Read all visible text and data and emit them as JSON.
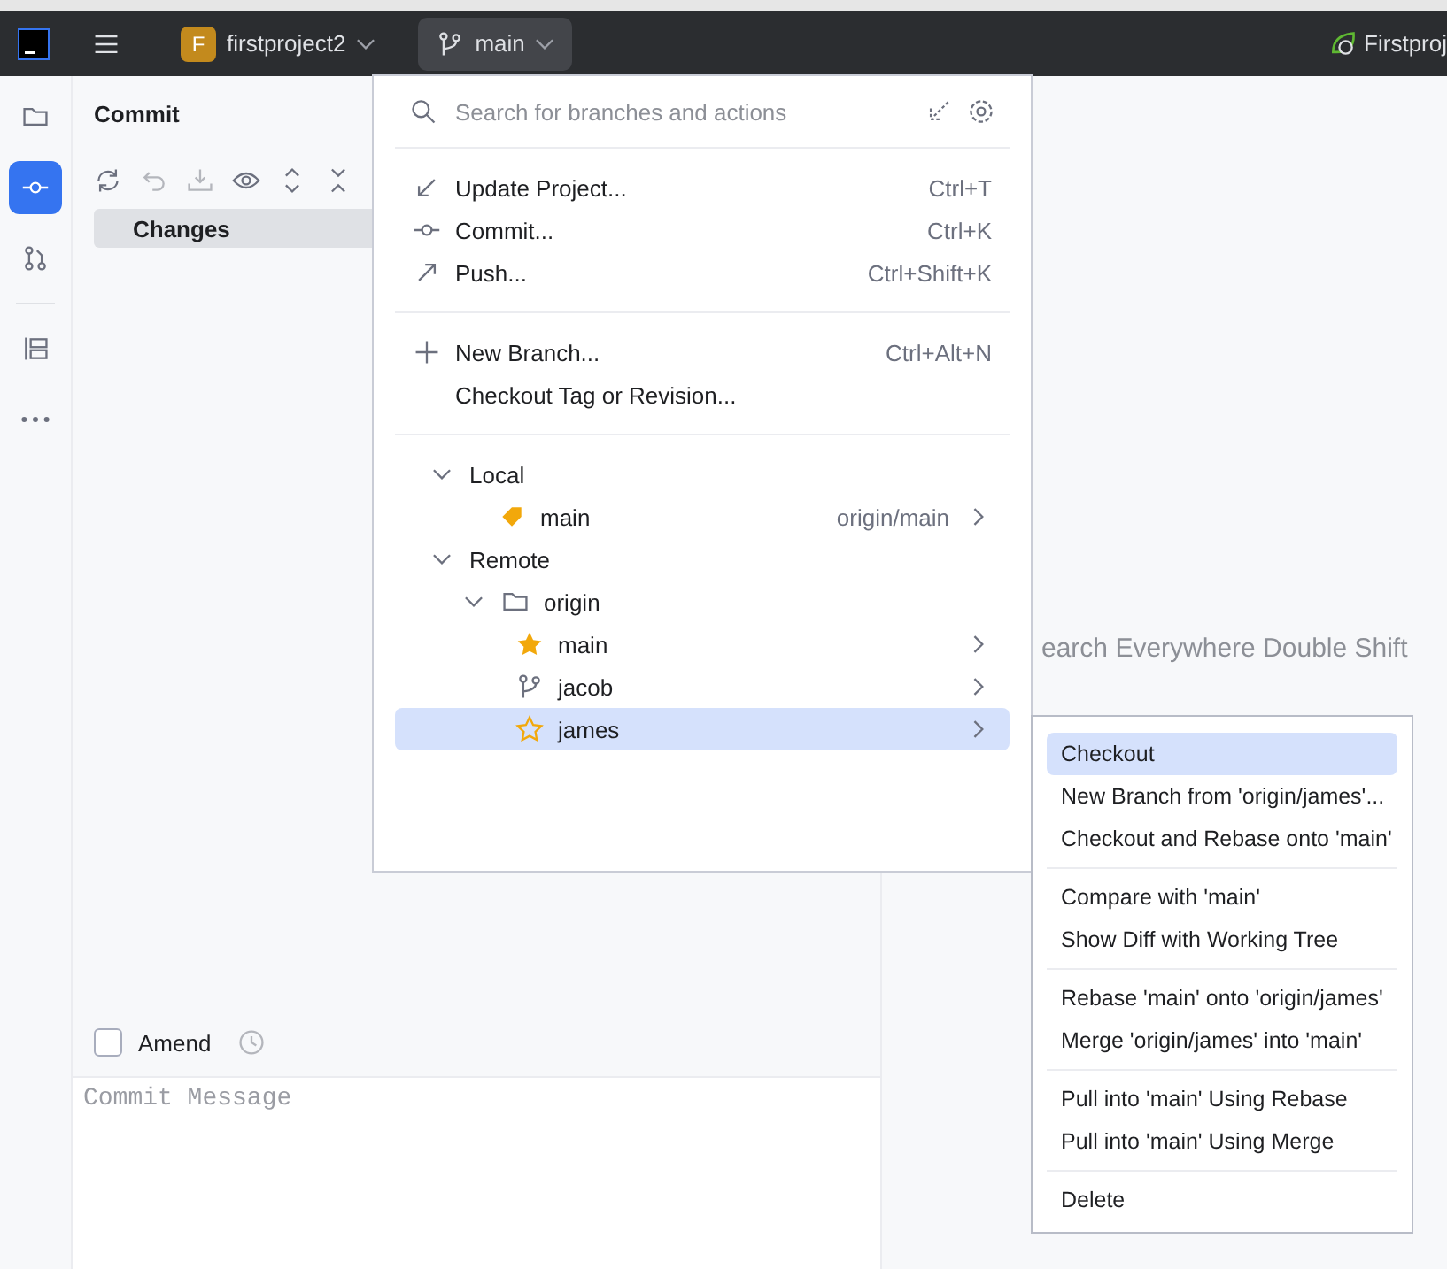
{
  "toolbar": {
    "project": {
      "initial": "F",
      "name": "firstproject2"
    },
    "branch": "main",
    "run_config": "Firstproj"
  },
  "tool_strip": [
    {
      "kind": "folder",
      "selected": false
    },
    {
      "kind": "commit",
      "selected": true
    },
    {
      "kind": "pull-requests",
      "selected": false
    },
    {
      "kind": "structure",
      "selected": false
    },
    {
      "kind": "more",
      "selected": false
    }
  ],
  "commit_panel": {
    "title": "Commit",
    "changes": {
      "label": "Changes",
      "selected": true
    },
    "amend": {
      "label": "Amend",
      "checked": false
    },
    "message": {
      "placeholder": "Commit Message"
    }
  },
  "editor_hints": [
    "earch Everywhere Double Shift"
  ],
  "branch_popup": {
    "search": {
      "placeholder": "Search for branches and actions"
    },
    "action_groups": [
      [
        {
          "kind": "update",
          "label": "Update Project...",
          "shortcut": "Ctrl+T"
        },
        {
          "kind": "commit",
          "label": "Commit...",
          "shortcut": "Ctrl+K"
        },
        {
          "kind": "push",
          "label": "Push...",
          "shortcut": "Ctrl+Shift+K"
        }
      ],
      [
        {
          "kind": "new",
          "label": "New Branch...",
          "shortcut": "Ctrl+Alt+N"
        },
        {
          "kind": "none",
          "label": "Checkout Tag or Revision..."
        }
      ]
    ],
    "tree": [
      {
        "kind": "group",
        "label": "Local",
        "expanded": true,
        "selected": false,
        "children": [
          {
            "kind": "tag",
            "label": "main",
            "tracking": "origin/main",
            "selected": false
          }
        ]
      },
      {
        "kind": "group",
        "label": "Remote",
        "expanded": true,
        "selected": false,
        "children": [
          {
            "kind": "folder",
            "label": "origin",
            "expanded": true,
            "selected": false,
            "children": [
              {
                "kind": "star",
                "label": "main",
                "selected": false
              },
              {
                "kind": "branch",
                "label": "jacob",
                "selected": false
              },
              {
                "kind": "star-outline",
                "label": "james",
                "selected": true
              }
            ]
          }
        ]
      }
    ]
  },
  "context_menu": {
    "groups": [
      [
        {
          "label": "Checkout",
          "selected": true
        },
        {
          "label": "New Branch from 'origin/james'...",
          "selected": false
        },
        {
          "label": "Checkout and Rebase onto 'main'",
          "selected": false
        }
      ],
      [
        {
          "label": "Compare with 'main'",
          "selected": false
        },
        {
          "label": "Show Diff with Working Tree",
          "selected": false
        }
      ],
      [
        {
          "label": "Rebase 'main' onto 'origin/james'",
          "selected": false
        },
        {
          "label": "Merge 'origin/james' into 'main'",
          "selected": false
        }
      ],
      [
        {
          "label": "Pull into 'main' Using Rebase",
          "selected": false
        },
        {
          "label": "Pull into 'main' Using Merge",
          "selected": false
        }
      ],
      [
        {
          "label": "Delete",
          "selected": false
        }
      ]
    ]
  }
}
